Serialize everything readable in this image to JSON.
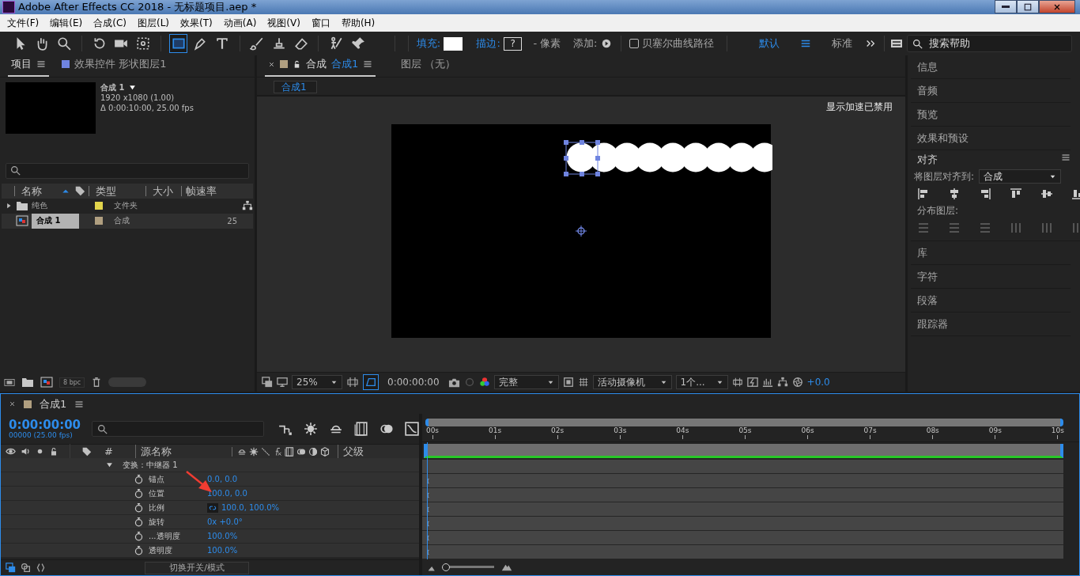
{
  "window": {
    "title": "Adobe After Effects CC 2018 - 无标题项目.aep *"
  },
  "menu": [
    "文件(F)",
    "编辑(E)",
    "合成(C)",
    "图层(L)",
    "效果(T)",
    "动画(A)",
    "视图(V)",
    "窗口",
    "帮助(H)"
  ],
  "toolbar": {
    "tools": [
      {
        "selected": false
      },
      {
        "selected": false
      },
      {
        "selected": false
      },
      {
        "selected": false
      },
      {
        "selected": false
      },
      {
        "selected": false
      },
      {
        "selected": true
      },
      {
        "selected": false
      },
      {
        "selected": false
      },
      {
        "selected": false
      },
      {
        "selected": false
      },
      {
        "selected": false
      },
      {
        "selected": false
      },
      {
        "selected": false
      }
    ],
    "fill_label": "填充:",
    "stroke_label": "描边:",
    "stroke_value": "?",
    "pixel_label": "- 像素",
    "add_label": "添加:",
    "bezier": {
      "label": "贝塞尔曲线路径",
      "checked": false
    },
    "workspaces": [
      {
        "label": "默认",
        "selected": true
      },
      {
        "label": "标准",
        "selected": false
      }
    ],
    "search": {
      "placeholder": "搜索帮助"
    }
  },
  "project": {
    "tabs": [
      {
        "label": "项目",
        "selected": true
      },
      {
        "label": "效果控件 形状图层1",
        "selected": false
      }
    ],
    "comp_name": "合成 1",
    "comp_size": "1920 x1080 (1.00)",
    "comp_duration": "Δ 0:00:10:00, 25.00 fps",
    "columns": [
      "名称",
      "类型",
      "大小",
      "帧速率"
    ],
    "items": [
      {
        "kind": "folder",
        "name": "纯色",
        "type": "文件夹",
        "color": "#e3d54c",
        "selected": false
      },
      {
        "kind": "comp",
        "name": "合成 1",
        "type": "合成",
        "fps": "25",
        "color": "#b09f80",
        "selected": true
      }
    ],
    "bpc": "8 bpc",
    "thumbnail_slider": {
      "level": 1
    }
  },
  "viewer": {
    "tabs": [
      {
        "label": "合成",
        "sub": "合成1",
        "selected": true
      },
      {
        "label": "图层 （无）",
        "selected": false
      }
    ],
    "breadcrumb": "合成1",
    "notice": "显示加速已禁用",
    "footer": {
      "zoom": "25%",
      "time": "0:00:00:00",
      "resolution": "完整",
      "camera": "活动摄像机",
      "views": "1个...",
      "exposure": "+0.0"
    }
  },
  "right_panel": {
    "top_items": [
      "信息",
      "音频",
      "预览",
      "效果和预设"
    ],
    "align": {
      "title": "对齐",
      "align_to_label": "将图层对齐到:",
      "align_to_value": "合成",
      "distribute_label": "分布图层:"
    },
    "bottom_items": [
      "库",
      "字符",
      "段落",
      "跟踪器"
    ]
  },
  "timeline": {
    "tab": "合成1",
    "timecode": "0:00:00:00",
    "frame_info": "00000 (25.00 fps)",
    "columns": [
      "#",
      "源名称",
      "父级"
    ],
    "ruler": [
      "00s",
      "01s",
      "02s",
      "03s",
      "04s",
      "05s",
      "06s",
      "07s",
      "08s",
      "09s",
      "10s"
    ],
    "group": {
      "label": "变换：中继器 1",
      "expanded": true
    },
    "properties": [
      {
        "name": "锚点",
        "value": "0.0, 0.0",
        "linked": false
      },
      {
        "name": "位置",
        "value": "100.0, 0.0",
        "linked": false
      },
      {
        "name": "比例",
        "value": "100.0, 100.0%",
        "linked": true
      },
      {
        "name": "旋转",
        "value": "0x +0.0°",
        "linked": false
      },
      {
        "name": "...透明度",
        "value": "100.0%",
        "linked": false
      },
      {
        "name": "透明度",
        "value": "100.0%",
        "linked": false
      }
    ],
    "footer": "切换开关/模式",
    "zoom_slider": {
      "level": 0.05
    }
  }
}
